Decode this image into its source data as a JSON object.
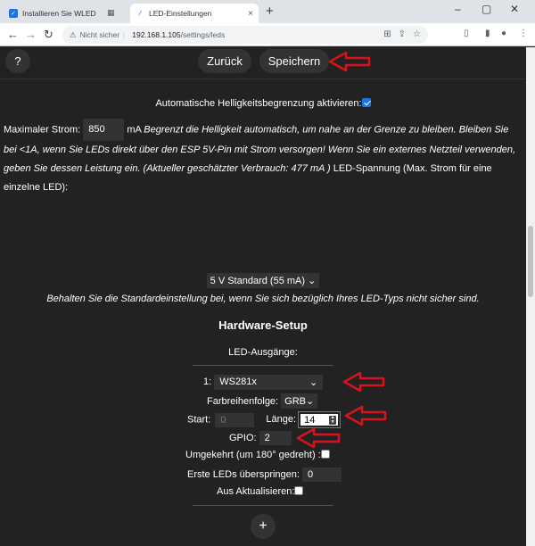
{
  "browser": {
    "tabs": [
      {
        "title": "Installieren Sie WLED",
        "active": false
      },
      {
        "title": "LED-Einstellungen",
        "active": true
      }
    ],
    "not_secure_label": "Nicht sicher",
    "url_host": "192.168.1.105",
    "url_path": "/settings/leds"
  },
  "topnav": {
    "help_label": "?",
    "back_label": "Zurück",
    "save_label": "Speichern"
  },
  "brightness": {
    "auto_limit_label": "Automatische Helligkeitsbegrenzung aktivieren:",
    "auto_limit_checked": true,
    "max_current_label": "Maximaler Strom:",
    "max_current_value": "850",
    "max_current_unit": "mA",
    "help_text_1": "Begrenzt die Helligkeit automatisch, um nahe an der Grenze zu bleiben. Bleiben Sie bei <1A, wenn Sie LEDs direkt über den ESP 5V-Pin mit Strom versorgen! Wenn Sie ein externes Netzteil verwenden, geben Sie dessen Leistung ein. (Aktueller geschätzter Verbrauch: ",
    "consumption_value": "477",
    "help_text_2": " mA )",
    "voltage_label": " LED-Spannung (Max. Strom für eine einzelne LED):",
    "voltage_select": "5 V Standard (55 mA)",
    "voltage_note": "Behalten Sie die Standardeinstellung bei, wenn Sie sich bezüglich Ihres LED-Typs nicht sicher sind."
  },
  "hardware": {
    "title": "Hardware-Setup",
    "outputs_label": "LED-Ausgänge:",
    "output_index": "1:",
    "led_type": "WS281x",
    "color_order_label": "Farbreihenfolge:",
    "color_order": "GRB",
    "start_label": "Start:",
    "start_value": "0",
    "length_label": "Länge:",
    "length_value": "14",
    "gpio_label": "GPIO:",
    "gpio_value": "2",
    "reversed_label": "Umgekehrt (um 180° gedreht) :",
    "reversed_checked": false,
    "skip_label": "Erste LEDs überspringen:",
    "skip_value": "0",
    "off_refresh_label": "Aus Aktualisieren:",
    "off_refresh_checked": false,
    "add_label": "+"
  },
  "colors": {
    "annotation_arrow": "#d9121b",
    "page_bg": "#222222",
    "control_bg": "#333333"
  }
}
